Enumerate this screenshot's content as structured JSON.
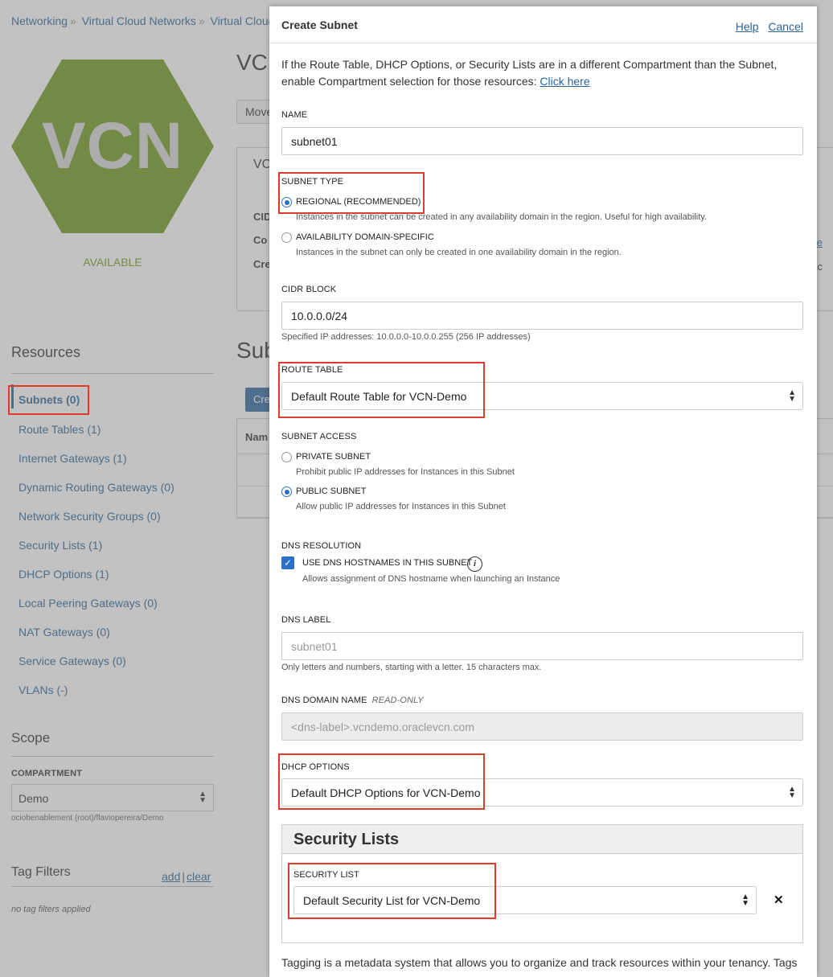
{
  "breadcrumb": {
    "items": [
      "Networking",
      "Virtual Cloud Networks",
      "Virtual Cloud"
    ],
    "separator": "»"
  },
  "vcn": {
    "icon_text": "VCN",
    "status": "AVAILABLE",
    "title": "VC",
    "move_button": "Move",
    "card_heading": "VC",
    "card_rows": [
      "CID",
      "Co",
      "Cre"
    ],
    "card_link": "oute",
    "card_text": "orac"
  },
  "subnets_section": {
    "title": "Sub",
    "create_button": "Cre",
    "name_column": "Nam"
  },
  "resources": {
    "title": "Resources",
    "items": [
      "Subnets (0)",
      "Route Tables (1)",
      "Internet Gateways (1)",
      "Dynamic Routing Gateways (0)",
      "Network Security Groups (0)",
      "Security Lists (1)",
      "DHCP Options (1)",
      "Local Peering Gateways (0)",
      "NAT Gateways (0)",
      "Service Gateways (0)",
      "VLANs (-)"
    ]
  },
  "scope": {
    "title": "Scope",
    "compartment_label": "COMPARTMENT",
    "compartment_value": "Demo",
    "compartment_path": "ociobenablement (root)/flaviopereira/Demo"
  },
  "tags": {
    "title": "Tag Filters",
    "add": "add",
    "clear": "clear",
    "separator": "|",
    "empty": "no tag filters applied"
  },
  "dialog": {
    "title": "Create Subnet",
    "help": "Help",
    "cancel": "Cancel",
    "intro": "If the Route Table, DHCP Options, or Security Lists are in a different Compartment than the Subnet, enable Compartment selection for those resources:",
    "intro_link": "Click here",
    "name_label": "NAME",
    "name_value": "subnet01",
    "subnet_type_label": "SUBNET TYPE",
    "regional_label": "REGIONAL (RECOMMENDED)",
    "regional_help": "Instances in the subnet can be created in any availability domain in the region. Useful for high availability.",
    "ad_label": "AVAILABILITY DOMAIN-SPECIFIC",
    "ad_help": "Instances in the subnet can only be created in one availability domain in the region.",
    "cidr_label": "CIDR BLOCK",
    "cidr_value": "10.0.0.0/24",
    "cidr_help": "Specified IP addresses: 10.0.0.0-10.0.0.255 (256 IP addresses)",
    "route_table_label": "ROUTE TABLE",
    "route_table_value": "Default Route Table for VCN-Demo",
    "access_label": "SUBNET ACCESS",
    "private_label": "PRIVATE SUBNET",
    "private_help": "Prohibit public IP addresses for Instances in this Subnet",
    "public_label": "PUBLIC SUBNET",
    "public_help": "Allow public IP addresses for Instances in this Subnet",
    "dns_resolution_label": "DNS RESOLUTION",
    "dns_check_label": "USE DNS HOSTNAMES IN THIS SUBNET",
    "dns_check_help": "Allows assignment of DNS hostname when launching an Instance",
    "dns_label_label": "DNS LABEL",
    "dns_label_placeholder": "subnet01",
    "dns_label_help": "Only letters and numbers, starting with a letter. 15 characters max.",
    "dns_domain_label": "DNS DOMAIN NAME",
    "dns_domain_readonly": "READ-ONLY",
    "dns_domain_value": "<dns-label>.vcndemo.oraclevcn.com",
    "dhcp_label": "DHCP OPTIONS",
    "dhcp_value": "Default DHCP Options for VCN-Demo",
    "security_lists_title": "Security Lists",
    "security_list_label": "SECURITY LIST",
    "security_list_value": "Default Security List for VCN-Demo",
    "footer_text": "Tagging is a metadata system that allows you to organize and track resources within your tenancy. Tags"
  },
  "state": {
    "subnet_type_selected": "regional",
    "subnet_access_selected": "public",
    "dns_hostnames_checked": true
  },
  "colors": {
    "link": "#2a6496",
    "accent": "#2a6fc9",
    "vcn_green": "#6e9a1e",
    "highlight": "#e03c2d"
  },
  "icons": {
    "select_chevron": "chevron-updown-icon",
    "info": "info-icon",
    "remove": "close-icon",
    "check": "checkmark-icon"
  }
}
